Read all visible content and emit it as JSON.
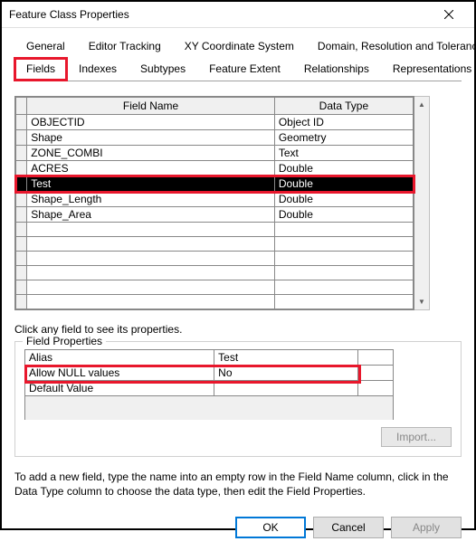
{
  "window": {
    "title": "Feature Class Properties"
  },
  "tabs_row1": [
    {
      "label": "General"
    },
    {
      "label": "Editor Tracking"
    },
    {
      "label": "XY Coordinate System"
    },
    {
      "label": "Domain, Resolution and Tolerance"
    }
  ],
  "tabs_row2": [
    {
      "label": "Fields",
      "active": true
    },
    {
      "label": "Indexes"
    },
    {
      "label": "Subtypes"
    },
    {
      "label": "Feature Extent"
    },
    {
      "label": "Relationships"
    },
    {
      "label": "Representations"
    }
  ],
  "fields_grid": {
    "headers": {
      "field_name": "Field Name",
      "data_type": "Data Type"
    },
    "rows": [
      {
        "name": "OBJECTID",
        "type": "Object ID"
      },
      {
        "name": "Shape",
        "type": "Geometry"
      },
      {
        "name": "ZONE_COMBI",
        "type": "Text"
      },
      {
        "name": "ACRES",
        "type": "Double"
      },
      {
        "name": "Test",
        "type": "Double",
        "selected": true
      },
      {
        "name": "Shape_Length",
        "type": "Double"
      },
      {
        "name": "Shape_Area",
        "type": "Double"
      },
      {
        "name": "",
        "type": ""
      },
      {
        "name": "",
        "type": ""
      },
      {
        "name": "",
        "type": ""
      },
      {
        "name": "",
        "type": ""
      },
      {
        "name": "",
        "type": ""
      },
      {
        "name": "",
        "type": ""
      }
    ]
  },
  "hint": "Click any field to see its properties.",
  "field_properties": {
    "legend": "Field Properties",
    "rows": [
      {
        "name": "Alias",
        "value": "Test"
      },
      {
        "name": "Allow NULL values",
        "value": "No",
        "highlight": true
      },
      {
        "name": "Default Value",
        "value": ""
      }
    ]
  },
  "import_button": "Import...",
  "help_text": "To add a new field, type the name into an empty row in the Field Name column, click in the Data Type column to choose the data type, then edit the Field Properties.",
  "buttons": {
    "ok": "OK",
    "cancel": "Cancel",
    "apply": "Apply"
  }
}
